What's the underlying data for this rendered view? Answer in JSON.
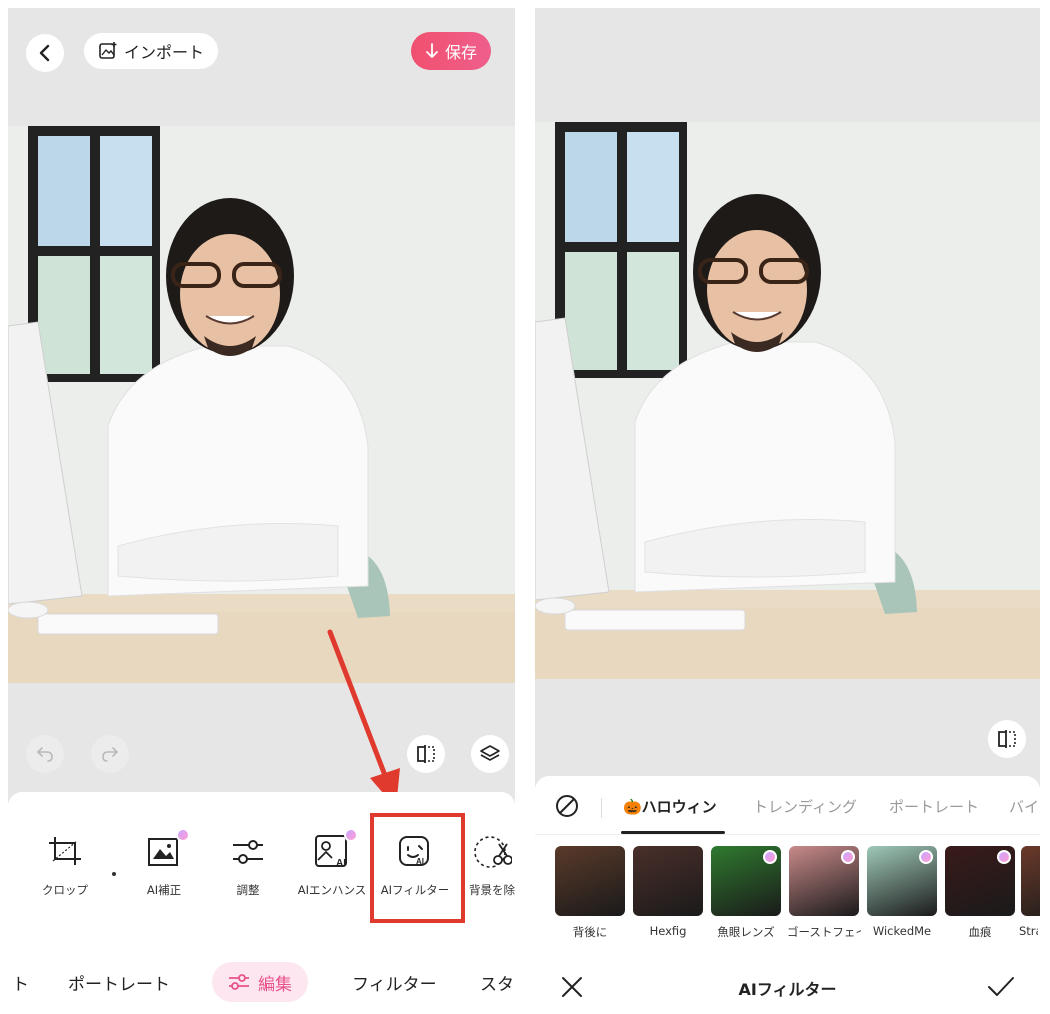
{
  "left_screen": {
    "top_bar": {
      "import_label": "インポート",
      "save_label": "保存"
    },
    "tools": [
      {
        "label": "クロップ"
      },
      {
        "label": "AI補正"
      },
      {
        "label": "調整"
      },
      {
        "label": "AIエンハンス"
      },
      {
        "label": "AIフィルター"
      },
      {
        "label": "背景を除"
      }
    ],
    "nav": {
      "items": [
        "ト",
        "ポートレート",
        "編集",
        "フィルター",
        "スタ"
      ],
      "active": "編集"
    }
  },
  "right_screen": {
    "tabs": [
      "🎃ハロウィン",
      "トレンディング",
      "ポートレート",
      "バイ"
    ],
    "active_tab": "🎃ハロウィン",
    "filters": [
      {
        "label": "背後に",
        "color": "#5a3a2a"
      },
      {
        "label": "Hexfig",
        "color": "#4a2f2a"
      },
      {
        "label": "魚眼レンズ",
        "color": "#2f7a2f"
      },
      {
        "label": "ゴーストフェイス",
        "color": "#c98a8a"
      },
      {
        "label": "WickedMe",
        "color": "#9fc9b8"
      },
      {
        "label": "血痕",
        "color": "#3a1a1a"
      },
      {
        "label": "Stra",
        "color": "#6a3a2a"
      }
    ],
    "title": "AIフィルター"
  },
  "colors": {
    "accent": "#e9528b",
    "highlight": "#e03a2f",
    "save_gradient": "#f0506e"
  }
}
